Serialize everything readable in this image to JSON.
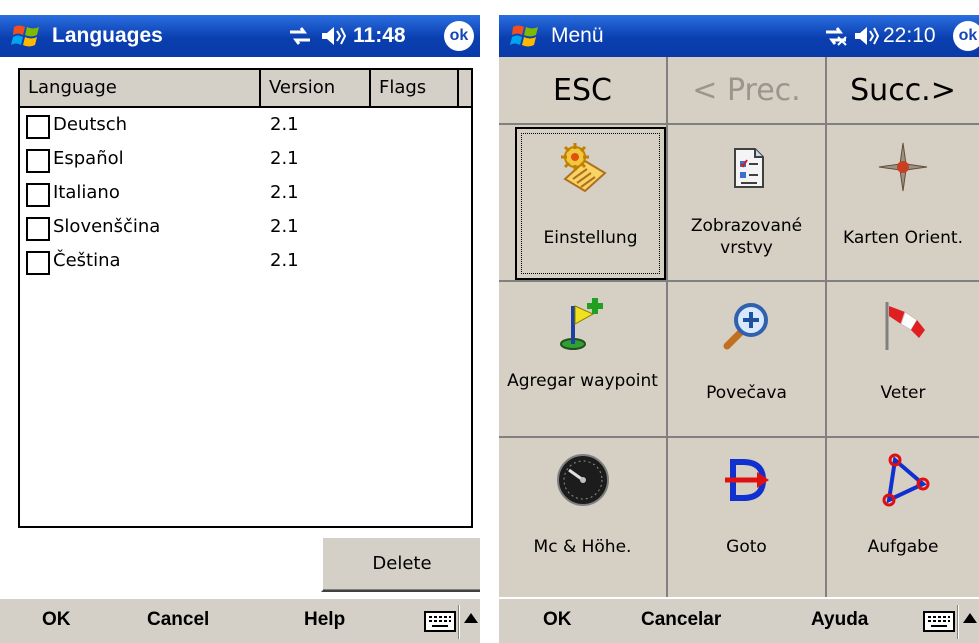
{
  "left": {
    "title": "Languages",
    "clock": "11:48",
    "ok": "ok",
    "columns": [
      "Language",
      "Version",
      "Flags"
    ],
    "rows": [
      {
        "name": "Deutsch",
        "version": "2.1"
      },
      {
        "name": "Español",
        "version": "2.1"
      },
      {
        "name": "Italiano",
        "version": "2.1"
      },
      {
        "name": "Slovenščina",
        "version": "2.1"
      },
      {
        "name": "Čeština",
        "version": "2.1"
      }
    ],
    "delete_label": "Delete",
    "cmd": {
      "ok": "OK",
      "cancel": "Cancel",
      "help": "Help"
    }
  },
  "right": {
    "title": "Menü",
    "clock": "22:10",
    "ok": "ok",
    "nav": {
      "esc": "ESC",
      "prev": "< Prec.",
      "next": "Succ.>"
    },
    "tiles": [
      {
        "label": "Einstellung",
        "icon": "settings-icon"
      },
      {
        "label": "Zobrazované vrstvy",
        "icon": "layers-document-icon"
      },
      {
        "label": "Karten Orient.",
        "icon": "compass-icon"
      },
      {
        "label": "Agregar waypoint",
        "icon": "add-waypoint-flag-icon"
      },
      {
        "label": "Povečava",
        "icon": "zoom-in-icon"
      },
      {
        "label": "Veter",
        "icon": "windsock-icon"
      },
      {
        "label": "Mc & Höhe.",
        "icon": "variometer-gauge-icon"
      },
      {
        "label": "Goto",
        "icon": "goto-arrow-icon"
      },
      {
        "label": "Aufgabe",
        "icon": "task-triangle-icon"
      }
    ],
    "cmd": {
      "ok": "OK",
      "cancel": "Cancelar",
      "help": "Ayuda"
    }
  }
}
